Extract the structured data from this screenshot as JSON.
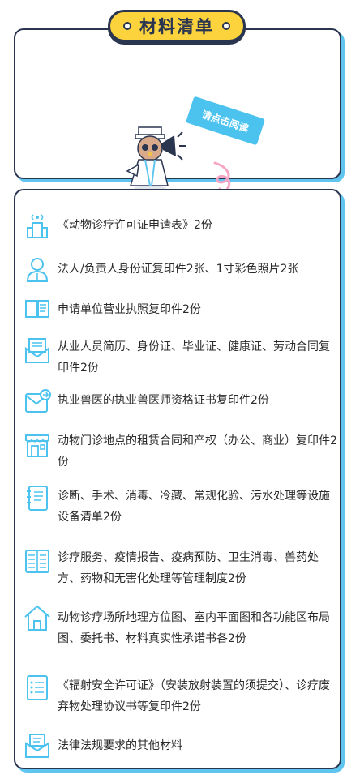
{
  "header": {
    "title": "材料清单",
    "speech_tag": "请点击阅读"
  },
  "colors": {
    "accent_blue": "#4cc3ef",
    "title_yellow": "#fcd33c",
    "border_dark": "#2a3550"
  },
  "items": [
    {
      "icon": "building-signal-icon",
      "text": "《动物诊疗许可证申请表》2份"
    },
    {
      "icon": "person-icon",
      "text": "法人/负责人身份证复印件2张、1寸彩色照片2张"
    },
    {
      "icon": "open-book-icon",
      "text": "申请单位营业执照复印件2份"
    },
    {
      "icon": "envelope-document-icon",
      "text": "从业人员简历、身份证、毕业证、健康证、劳动合同复印件2份"
    },
    {
      "icon": "envelope-forward-icon",
      "text": "执业兽医的执业兽医师资格证书复印件2份"
    },
    {
      "icon": "storefront-icon",
      "text": "动物门诊地点的租赁合同和产权（办公、商业）复印件2份"
    },
    {
      "icon": "notebook-icon",
      "text": "诊断、手术、消毒、冷藏、常规化验、污水处理等设施设备清单2份"
    },
    {
      "icon": "newspaper-icon",
      "text": "诊疗服务、疫情报告、疫病预防、卫生消毒、兽药处方、药物和无害化处理等管理制度2份"
    },
    {
      "icon": "house-icon",
      "text": "动物诊疗场所地理方位图、室内平面图和各功能区布局图、委托书、材料真实性承诺书各2份"
    },
    {
      "icon": "checklist-icon",
      "text": "《辐射安全许可证》（安装放射装置的须提交）、诊疗废弃物处理协议书等复印件2份"
    },
    {
      "icon": "mail-tray-icon",
      "text": "法律法规要求的其他材料"
    }
  ]
}
